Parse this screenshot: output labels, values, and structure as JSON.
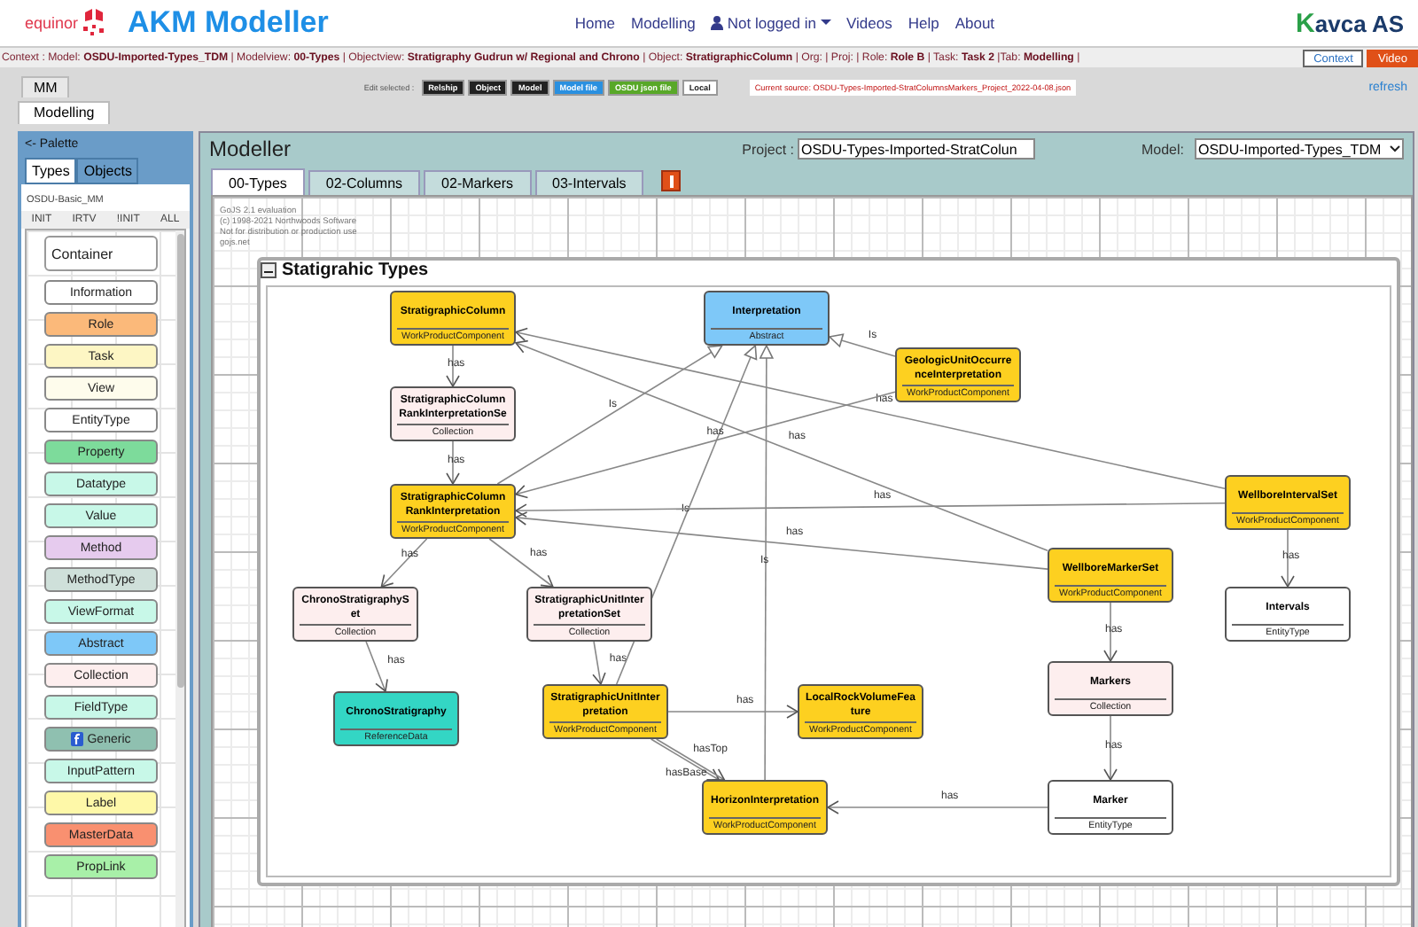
{
  "header": {
    "company_logo": "equinor",
    "app_title": "AKM Modeller",
    "nav": [
      {
        "label": "Home",
        "kind": "link"
      },
      {
        "label": "Modelling",
        "kind": "link"
      },
      {
        "label": "Not logged in",
        "kind": "user"
      },
      {
        "label": "Videos",
        "kind": "link"
      },
      {
        "label": "Help",
        "kind": "link"
      },
      {
        "label": "About",
        "kind": "link"
      }
    ],
    "brand_initial": "K",
    "brand_rest": "avca AS"
  },
  "context_bar": {
    "text": "Context : Model: **OSDU-Imported-Types_TDM** | Modelview: **00-Types** | Objectview: **Stratigraphy Gudrun w/ Regional and Chrono** | Object: **StratigraphicColumn** | Org: | Proj: | Role: **Role B** | Task: **Task 2** |Tab: **Modelling** |",
    "buttons": [
      {
        "label": "Context",
        "kind": "outline"
      },
      {
        "label": "Video",
        "kind": "filled"
      }
    ]
  },
  "page_tabs": [
    {
      "label": "MM",
      "selected": false
    },
    {
      "label": "Modelling",
      "selected": true
    }
  ],
  "toolbar": {
    "label": "Edit selected :",
    "buttons": [
      {
        "label": "Relship",
        "kind": "dark"
      },
      {
        "label": "Object",
        "kind": "dark"
      },
      {
        "label": "Model",
        "kind": "dark"
      },
      {
        "label": "Model file",
        "kind": "blue"
      },
      {
        "label": "OSDU json file",
        "kind": "green"
      },
      {
        "label": "Local",
        "kind": "light"
      }
    ],
    "source": "Current source: OSDU-Types-Imported-StratColumnsMarkers_Project_2022-04-08.json",
    "refresh": "refresh"
  },
  "palette": {
    "title": "<- Palette",
    "tabs": [
      {
        "label": "Types",
        "selected": true
      },
      {
        "label": "Objects",
        "selected": false
      }
    ],
    "metamodel": "OSDU-Basic_MM",
    "buttons": [
      "INIT",
      "IRTV",
      "!INIT",
      "ALL"
    ],
    "items": [
      {
        "label": "Container",
        "kind": "group",
        "color": "#ffffff"
      },
      {
        "label": "Information",
        "kind": "type",
        "color": "#ffffff"
      },
      {
        "label": "Role",
        "kind": "type",
        "color": "#fbb97a"
      },
      {
        "label": "Task",
        "kind": "type",
        "color": "#fdf6c4"
      },
      {
        "label": "View",
        "kind": "type",
        "color": "#fefcec"
      },
      {
        "label": "EntityType",
        "kind": "type",
        "color": "#ffffff"
      },
      {
        "label": "Property",
        "kind": "type",
        "color": "#7ddb9b"
      },
      {
        "label": "Datatype",
        "kind": "type",
        "color": "#c8f8e8"
      },
      {
        "label": "Value",
        "kind": "type",
        "color": "#c8f8e8"
      },
      {
        "label": "Method",
        "kind": "type",
        "color": "#e6cbee"
      },
      {
        "label": "MethodType",
        "kind": "type",
        "color": "#cfe0da"
      },
      {
        "label": "ViewFormat",
        "kind": "type",
        "color": "#c8f8e8"
      },
      {
        "label": "Abstract",
        "kind": "type",
        "color": "#7ec8f8"
      },
      {
        "label": "Collection",
        "kind": "type",
        "color": "#fdeeee"
      },
      {
        "label": "FieldType",
        "kind": "type",
        "color": "#c8f8e8"
      },
      {
        "label": "Generic",
        "kind": "icon_type",
        "color": "#8fc0b0"
      },
      {
        "label": "InputPattern",
        "kind": "type",
        "color": "#c8f8e8"
      },
      {
        "label": "Label",
        "kind": "type",
        "color": "#fef8a8"
      },
      {
        "label": "MasterData",
        "kind": "type",
        "color": "#f99070"
      },
      {
        "label": "PropLink",
        "kind": "type",
        "color": "#a8f0a8"
      }
    ]
  },
  "modeller": {
    "title": "Modeller",
    "project_label": "Project :",
    "project_value": "OSDU-Types-Imported-StratColun",
    "model_label": "Model:",
    "model_value": "OSDU-Imported-Types_TDM",
    "tabs": [
      {
        "label": "00-Types",
        "selected": true
      },
      {
        "label": "02-Columns",
        "selected": false
      },
      {
        "label": "02-Markers",
        "selected": false
      },
      {
        "label": "03-Intervals",
        "selected": false
      }
    ],
    "watermark": [
      "GoJS 2.1 evaluation",
      "(c) 1998-2021 Northwoods Software",
      "Not for distribution or production use",
      "gojs.net"
    ],
    "group": {
      "title": "Statigrahic Types",
      "expanded": true
    },
    "nodes": [
      {
        "name": "StratigraphicColumn",
        "type": "WorkProductComponent",
        "color": "#fdd020"
      },
      {
        "name": "Interpretation",
        "type": "Abstract",
        "color": "#7ec8f8"
      },
      {
        "name": "GeologicUnitOccurrenceInterpretation",
        "type": "WorkProductComponent",
        "color": "#fdd020"
      },
      {
        "name": "StratigraphicColumnRankInterpretationSe",
        "type": "Collection",
        "color": "#fdeeee"
      },
      {
        "name": "StratigraphicColumnRankInterpretation",
        "type": "WorkProductComponent",
        "color": "#fdd020"
      },
      {
        "name": "WellboreIntervalSet",
        "type": "WorkProductComponent",
        "color": "#fdd020"
      },
      {
        "name": "ChronoStratigraphySet",
        "type": "Collection",
        "color": "#fdeeee"
      },
      {
        "name": "StratigraphicUnitInterpretationSet",
        "type": "Collection",
        "color": "#fdeeee"
      },
      {
        "name": "WellboreMarkerSet",
        "type": "WorkProductComponent",
        "color": "#fdd020"
      },
      {
        "name": "Intervals",
        "type": "EntityType",
        "color": "#ffffff"
      },
      {
        "name": "ChronoStratigraphy",
        "type": "ReferenceData",
        "color": "#33d6c4"
      },
      {
        "name": "StratigraphicUnitInterpretation",
        "type": "WorkProductComponent",
        "color": "#fdd020"
      },
      {
        "name": "LocalRockVolumeFeature",
        "type": "WorkProductComponent",
        "color": "#fdd020"
      },
      {
        "name": "Markers",
        "type": "Collection",
        "color": "#fdeeee"
      },
      {
        "name": "HorizonInterpretation",
        "type": "WorkProductComponent",
        "color": "#fdd020"
      },
      {
        "name": "Marker",
        "type": "EntityType",
        "color": "#ffffff"
      }
    ],
    "links": [
      {
        "label": "has",
        "kind": "association"
      },
      {
        "label": "has",
        "kind": "association"
      },
      {
        "label": "has",
        "kind": "association"
      },
      {
        "label": "has",
        "kind": "association"
      },
      {
        "label": "has",
        "kind": "association"
      },
      {
        "label": "has",
        "kind": "association"
      },
      {
        "label": "has",
        "kind": "association"
      },
      {
        "label": "hasTop",
        "kind": "association"
      },
      {
        "label": "hasBase",
        "kind": "association"
      },
      {
        "label": "Is",
        "kind": "generalization"
      },
      {
        "label": "Is",
        "kind": "generalization"
      },
      {
        "label": "Is",
        "kind": "generalization"
      },
      {
        "label": "Is",
        "kind": "generalization"
      },
      {
        "label": "has",
        "kind": "association"
      },
      {
        "label": "has",
        "kind": "association"
      },
      {
        "label": "has",
        "kind": "association"
      },
      {
        "label": "has",
        "kind": "association"
      },
      {
        "label": "has",
        "kind": "association"
      },
      {
        "label": "has",
        "kind": "association"
      },
      {
        "label": "has",
        "kind": "association"
      },
      {
        "label": "has",
        "kind": "association"
      },
      {
        "label": "has",
        "kind": "association"
      }
    ]
  }
}
